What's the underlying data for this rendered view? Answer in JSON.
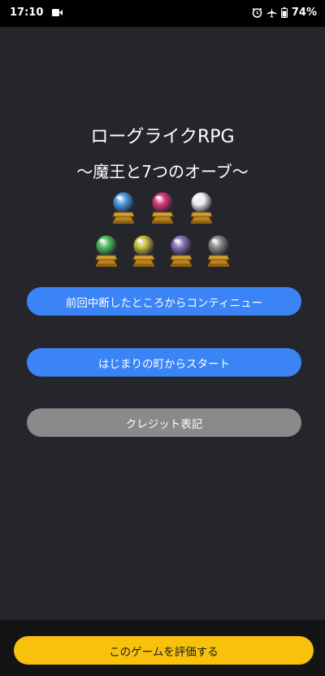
{
  "status_bar": {
    "time": "17:10",
    "battery": "74%",
    "icons": [
      "video-record-icon",
      "alarm-icon",
      "airplane-icon",
      "battery-icon"
    ]
  },
  "game": {
    "title": "ローグライクRPG",
    "subtitle": "〜魔王と7つのオーブ〜",
    "orbs": [
      {
        "name": "blue",
        "color": "#4a9ee8"
      },
      {
        "name": "pink",
        "color": "#e0387a"
      },
      {
        "name": "white",
        "color": "#f2f2f2"
      },
      {
        "name": "green",
        "color": "#4fc25a"
      },
      {
        "name": "yellow",
        "color": "#c9c23a"
      },
      {
        "name": "purple",
        "color": "#8a74b8"
      },
      {
        "name": "gray",
        "color": "#8c8c8c"
      }
    ]
  },
  "menu": {
    "continue_label": "前回中断したところからコンティニュー",
    "start_label": "はじまりの町からスタート",
    "credits_label": "クレジット表記"
  },
  "footer": {
    "rate_label": "このゲームを評価する"
  },
  "colors": {
    "background": "#25252c",
    "primary_button": "#3b84f5",
    "secondary_button": "#8a8a8a",
    "rate_button": "#f7c10c"
  }
}
